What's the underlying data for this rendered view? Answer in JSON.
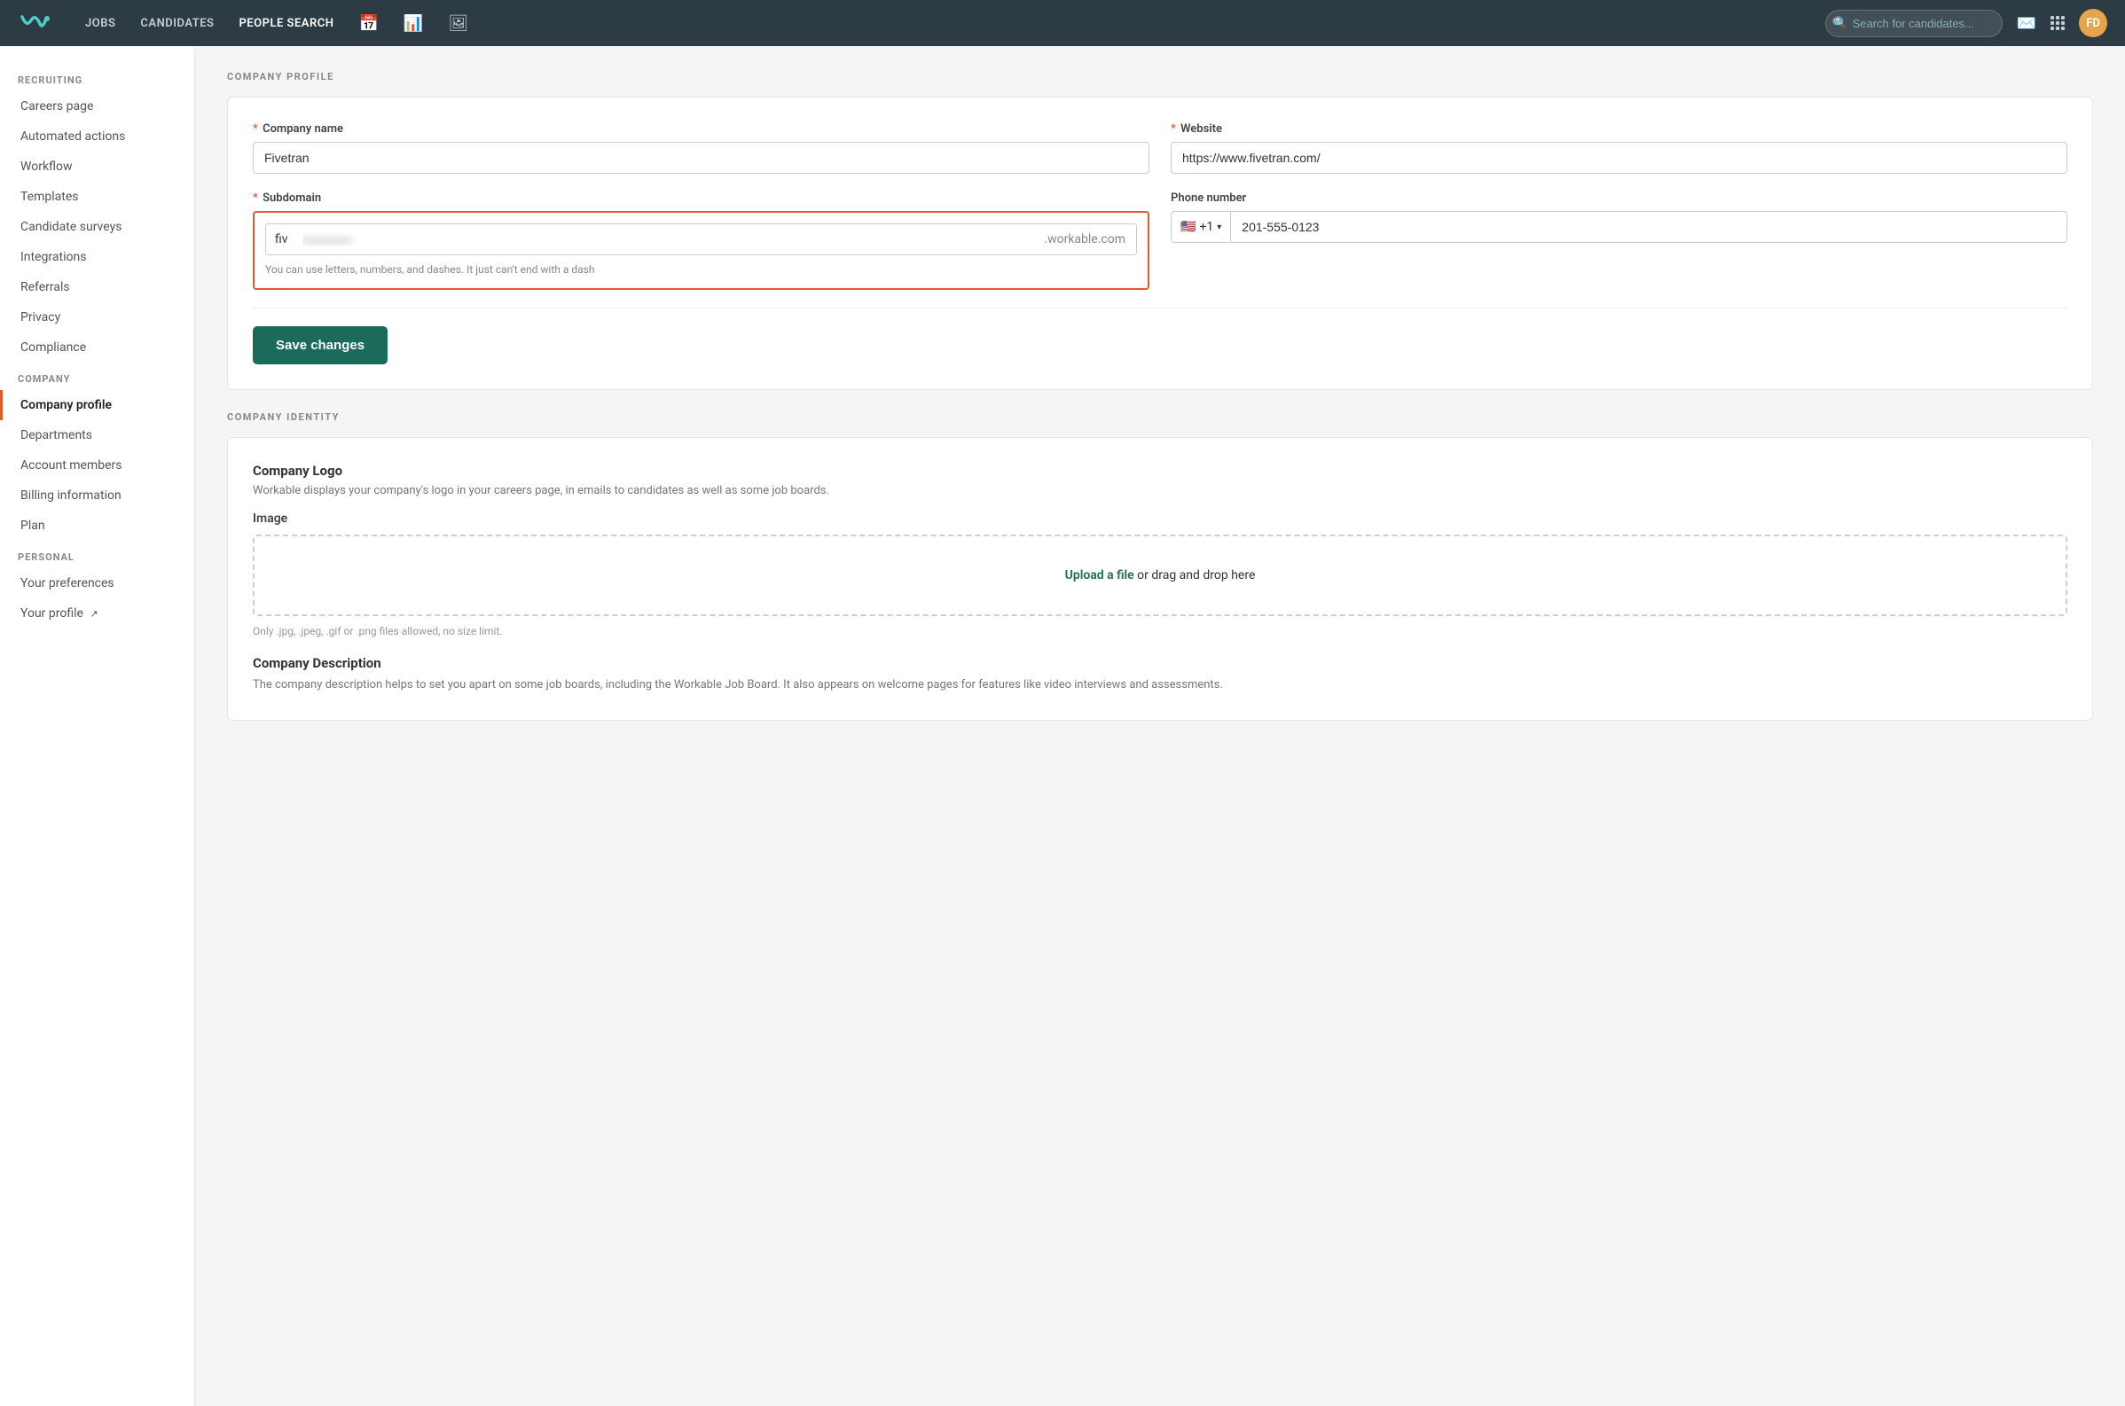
{
  "nav": {
    "logo_symbol": "W",
    "links": [
      {
        "label": "JOBS",
        "active": false
      },
      {
        "label": "CANDIDATES",
        "active": false
      },
      {
        "label": "PEOPLE SEARCH",
        "active": true
      }
    ],
    "search_placeholder": "Search for candidates...",
    "avatar_initials": "FD"
  },
  "sidebar": {
    "sections": [
      {
        "title": "RECRUITING",
        "items": [
          {
            "label": "Careers page",
            "active": false
          },
          {
            "label": "Automated actions",
            "active": false
          },
          {
            "label": "Workflow",
            "active": false
          },
          {
            "label": "Templates",
            "active": false
          },
          {
            "label": "Candidate surveys",
            "active": false
          },
          {
            "label": "Integrations",
            "active": false
          },
          {
            "label": "Referrals",
            "active": false
          },
          {
            "label": "Privacy",
            "active": false
          },
          {
            "label": "Compliance",
            "active": false
          }
        ]
      },
      {
        "title": "COMPANY",
        "items": [
          {
            "label": "Company profile",
            "active": true
          },
          {
            "label": "Departments",
            "active": false
          },
          {
            "label": "Account members",
            "active": false
          },
          {
            "label": "Billing information",
            "active": false
          },
          {
            "label": "Plan",
            "active": false
          }
        ]
      },
      {
        "title": "PERSONAL",
        "items": [
          {
            "label": "Your preferences",
            "active": false
          },
          {
            "label": "Your profile",
            "active": false,
            "external": true
          }
        ]
      }
    ]
  },
  "main": {
    "company_profile_section_title": "COMPANY PROFILE",
    "form": {
      "company_name_label": "Company name",
      "company_name_value": "Fivetran",
      "website_label": "Website",
      "website_value": "https://www.fivetran.com/",
      "subdomain_label": "Subdomain",
      "subdomain_prefix": "fiv",
      "subdomain_blurred": "xxxxxxxx",
      "subdomain_suffix": ".workable.com",
      "subdomain_hint": "You can use letters, numbers, and dashes. It just can't end with a dash",
      "phone_label": "Phone number",
      "phone_flag": "🇺🇸",
      "phone_code": "+1",
      "phone_value": "201-555-0123",
      "save_button_label": "Save changes"
    },
    "company_identity_section_title": "COMPANY IDENTITY",
    "identity": {
      "logo_label": "Company Logo",
      "logo_desc": "Workable displays your company's logo in your careers page, in emails to candidates as well as some job boards.",
      "image_label": "Image",
      "upload_link_text": "Upload a file",
      "upload_drag_text": " or drag and drop here",
      "upload_hint": "Only .jpg, .jpeg, .gif or .png files allowed, no size limit.",
      "desc_label": "Company Description",
      "desc_text": "The company description helps to set you apart on some job boards, including the Workable Job Board. It also appears on welcome pages for features like video interviews and assessments."
    }
  }
}
